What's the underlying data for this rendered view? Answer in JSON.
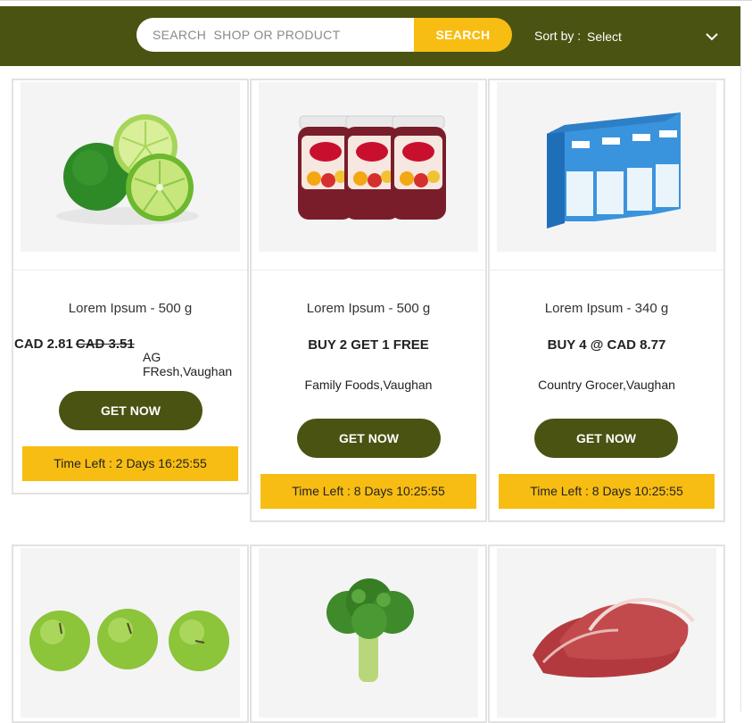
{
  "header": {
    "search_placeholder": "SEARCH  SHOP OR PRODUCT",
    "search_button": "SEARCH",
    "sort_label": "Sort by :",
    "sort_value": "Select"
  },
  "products": [
    {
      "title": "Lorem Ipsum - 500 g",
      "price": "CAD 2.81",
      "old_price": "CAD 3.51",
      "store": "AG FResh,Vaughan",
      "button": "GET NOW",
      "timer": "Time Left : 2 Days 16:25:55",
      "image": "limes-image"
    },
    {
      "title": "Lorem Ipsum - 500 g",
      "deal": "BUY 2 GET 1 FREE",
      "store": "Family Foods,Vaughan",
      "button": "GET NOW",
      "timer": "Time Left : 8 Days 10:25:55",
      "image": "jam-jars-image"
    },
    {
      "title": "Lorem Ipsum - 340 g",
      "deal": "BUY 4 @ CAD 8.77",
      "store": "Country Grocer,Vaughan",
      "button": "GET NOW",
      "timer": "Time Left : 8 Days 10:25:55",
      "image": "milk-cartons-image"
    },
    {
      "image": "green-apples-image"
    },
    {
      "image": "broccoli-image"
    },
    {
      "image": "raw-meat-image"
    }
  ],
  "colors": {
    "header_bg": "#4a5311",
    "accent_yellow": "#f8bd12",
    "button_bg": "#4a5311"
  }
}
